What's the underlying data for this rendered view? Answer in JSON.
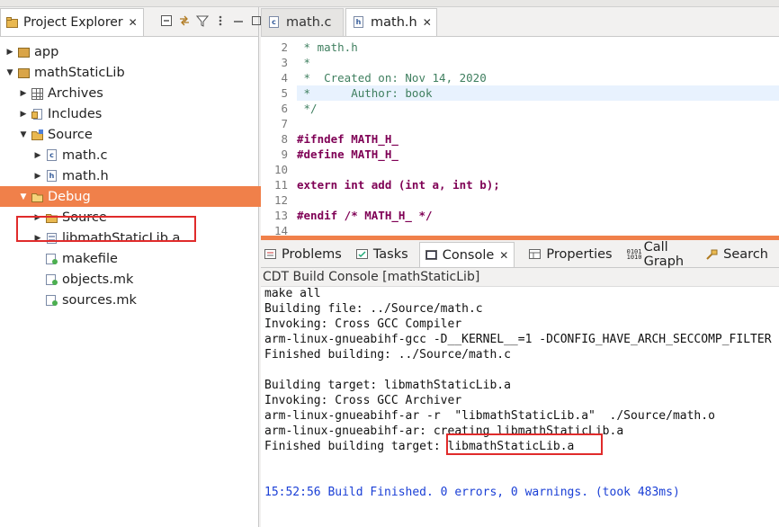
{
  "explorer": {
    "title": "Project Explorer",
    "tree": [
      {
        "label": "app",
        "twisty": "▶",
        "icon": "project-folder-icon"
      },
      {
        "label": "mathStaticLib",
        "twisty": "▼",
        "icon": "project-folder-icon"
      },
      {
        "label": "Archives",
        "twisty": "▶",
        "icon": "archives-icon"
      },
      {
        "label": "Includes",
        "twisty": "▶",
        "icon": "includes-icon"
      },
      {
        "label": "Source",
        "twisty": "▼",
        "icon": "source-folder-icon"
      },
      {
        "label": "math.c",
        "twisty": "▶",
        "icon": "c-file-icon"
      },
      {
        "label": "math.h",
        "twisty": "▶",
        "icon": "h-file-icon"
      },
      {
        "label": "Debug",
        "twisty": "▼",
        "icon": "folder-icon",
        "selected": true
      },
      {
        "label": "Source",
        "twisty": "▶",
        "icon": "folder-icon"
      },
      {
        "label": "libmathStaticLib.a",
        "twisty": "▶",
        "icon": "archive-file-icon"
      },
      {
        "label": "makefile",
        "twisty": "",
        "icon": "make-file-icon"
      },
      {
        "label": "objects.mk",
        "twisty": "",
        "icon": "make-file-icon"
      },
      {
        "label": "sources.mk",
        "twisty": "",
        "icon": "make-file-icon"
      }
    ]
  },
  "editor": {
    "tabs": [
      {
        "label": "math.c",
        "active": false
      },
      {
        "label": "math.h",
        "active": true
      }
    ],
    "lines": [
      {
        "num": "2",
        "text": " * math.h"
      },
      {
        "num": "3",
        "text": " *"
      },
      {
        "num": "4",
        "text": " *  Created on: Nov 14, 2020"
      },
      {
        "num": "5",
        "text": " *      Author: book"
      },
      {
        "num": "6",
        "text": " */"
      },
      {
        "num": "7",
        "text": ""
      },
      {
        "num": "8",
        "text": "#ifndef MATH_H_"
      },
      {
        "num": "9",
        "text": "#define MATH_H_"
      },
      {
        "num": "10",
        "text": ""
      },
      {
        "num": "11",
        "text": "extern int add (int a, int b);"
      },
      {
        "num": "12",
        "text": ""
      },
      {
        "num": "13",
        "text": "#endif /* MATH_H_ */"
      },
      {
        "num": "14",
        "text": ""
      }
    ]
  },
  "console": {
    "tabs": [
      "Problems",
      "Tasks",
      "Console",
      "Properties",
      "Call Graph",
      "Search"
    ],
    "header": "CDT Build Console [mathStaticLib]",
    "lines": [
      "make all",
      "Building file: ../Source/math.c",
      "Invoking: Cross GCC Compiler",
      "arm-linux-gnueabihf-gcc -D__KERNEL__=1 -DCONFIG_HAVE_ARCH_SECCOMP_FILTER",
      "Finished building: ../Source/math.c",
      "",
      "Building target: libmathStaticLib.a",
      "Invoking: Cross GCC Archiver",
      "arm-linux-gnueabihf-ar -r  \"libmathStaticLib.a\"  ./Source/math.o",
      "arm-linux-gnueabihf-ar: creating libmathStaticLib.a",
      "Finished building target: libmathStaticLib.a",
      "",
      "",
      "15:52:56 Build Finished. 0 errors, 0 warnings. (took 483ms)"
    ]
  },
  "colors": {
    "selection": "#f0804a",
    "highlight_box": "#e02b2b",
    "keyword": "#7f0055",
    "comment": "#3f7f5f",
    "build_finished": "#1a3fd6"
  }
}
